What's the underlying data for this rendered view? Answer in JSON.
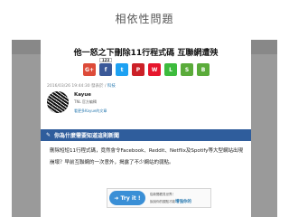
{
  "slide": {
    "title": "相依性問題"
  },
  "article": {
    "title": "他一怒之下刪除11行程式碼 互聯網遭殃",
    "share": [
      {
        "icon": "google-plus-icon",
        "glyph": "G+",
        "color": "#dd4b39"
      },
      {
        "icon": "facebook-icon",
        "glyph": "f",
        "color": "#3b5998",
        "count": "123"
      },
      {
        "icon": "twitter-icon",
        "glyph": "t",
        "color": "#1da1f2"
      },
      {
        "icon": "pinterest-icon",
        "glyph": "P",
        "color": "#cb2027"
      },
      {
        "icon": "weibo-icon",
        "glyph": "W",
        "color": "#e6162d"
      },
      {
        "icon": "line-icon",
        "glyph": "L",
        "color": "#3dbb3d"
      },
      {
        "icon": "share-icon",
        "glyph": "S",
        "color": "#5aab3a"
      },
      {
        "icon": "bookmark-icon",
        "glyph": "B",
        "color": "#5aab3a"
      }
    ],
    "meta_prefix": "2016/03/26 19:44:30 發表於 / ",
    "meta_category": "科技",
    "author": {
      "name": "Kayue",
      "role": "TNL 官方編輯",
      "link": "看更多Kayue的文章"
    },
    "section_heading": "你為什麼需要知道這則新聞",
    "body": "刪除短短11行程式碼，竟然會令Facebook、Reddit、Netflix及Spotify等大型網站出現崩壞？早前互聯網的一次意外，揭露了不少網站的弱點。",
    "try_it": {
      "button": "Try it !",
      "line1": "從新聞看見世界！",
      "line2_prefix": "說說你的觀點才能",
      "line2_highlight": "增強你的"
    }
  }
}
